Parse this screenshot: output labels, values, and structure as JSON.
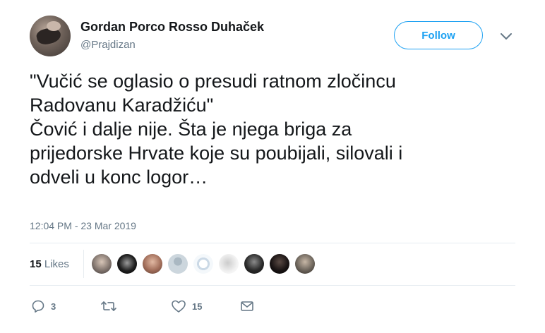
{
  "user": {
    "display_name": "Gordan Porco Rosso Duhaček",
    "handle": "@Prajdizan"
  },
  "follow_label": "Follow",
  "tweet": {
    "text": "\"Vučić se oglasio o presudi ratnom zločincu\nRadovanu Karadžiću\"\nČović i dalje nije. Šta je njega briga za\nprijedorske Hrvate koje su poubijali, silovali i\nodveli u konc logor…",
    "timestamp": "12:04 PM - 23 Mar 2019"
  },
  "likes": {
    "count": "15",
    "label": "Likes"
  },
  "actions": {
    "reply_count": "3",
    "retweet_count": "",
    "like_count": "15"
  },
  "colors": {
    "accent": "#1da1f2",
    "secondary_text": "#657786",
    "divider": "#e6ecf0"
  },
  "icons": {
    "reply": "reply-icon",
    "retweet": "retweet-icon",
    "like": "heart-icon",
    "dm": "envelope-icon",
    "more": "chevron-down-icon"
  }
}
